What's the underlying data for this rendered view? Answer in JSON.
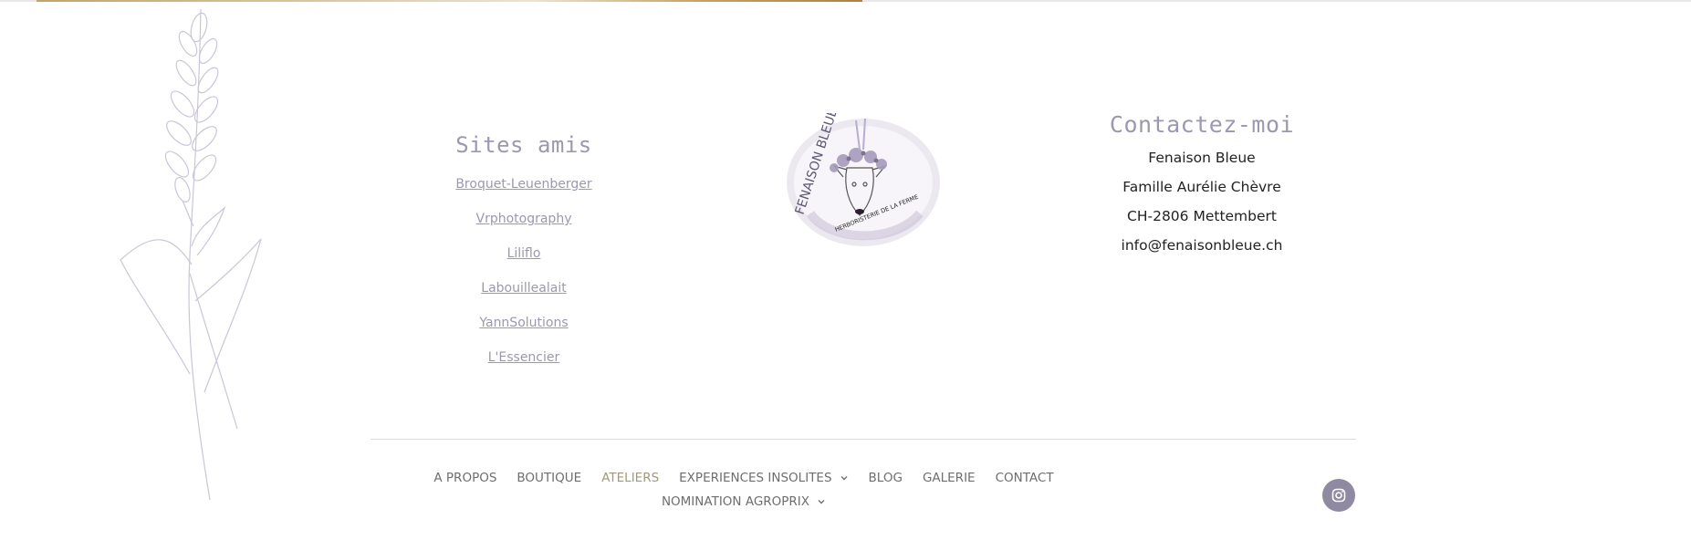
{
  "friends": {
    "title": "Sites amis",
    "links": [
      {
        "label": "Broquet-Leuenberger"
      },
      {
        "label": "Vrphotography"
      },
      {
        "label": "Liliflo"
      },
      {
        "label": "Labouillealait"
      },
      {
        "label": "YannSolutions"
      },
      {
        "label": "L'Essencier"
      }
    ]
  },
  "logo": {
    "top_text": "FENAISON BLEUE",
    "bottom_text": "HERBORISTERIE DE LA FERME"
  },
  "contact": {
    "title": "Contactez-moi",
    "lines": [
      "Fenaison Bleue",
      "Famille Aurélie Chèvre",
      "CH-2806 Mettembert",
      "info@fenaisonbleue.ch"
    ]
  },
  "nav": {
    "row1": [
      {
        "label": "A PROPOS",
        "active": false
      },
      {
        "label": "BOUTIQUE",
        "active": false
      },
      {
        "label": "ATELIERS",
        "active": true
      },
      {
        "label": "EXPERIENCES INSOLITES",
        "active": false,
        "dropdown": true
      },
      {
        "label": "BLOG",
        "active": false
      },
      {
        "label": "GALERIE",
        "active": false
      },
      {
        "label": "CONTACT",
        "active": false
      }
    ],
    "row2": [
      {
        "label": "NOMINATION AGROPRIX",
        "active": false,
        "dropdown": true
      }
    ]
  },
  "social": {
    "icon": "instagram-icon"
  },
  "colors": {
    "accent": "#9d97b0",
    "active_nav": "#a09a7a",
    "nav_text": "#6e6e6e",
    "social_bg": "#8f8aa1"
  }
}
